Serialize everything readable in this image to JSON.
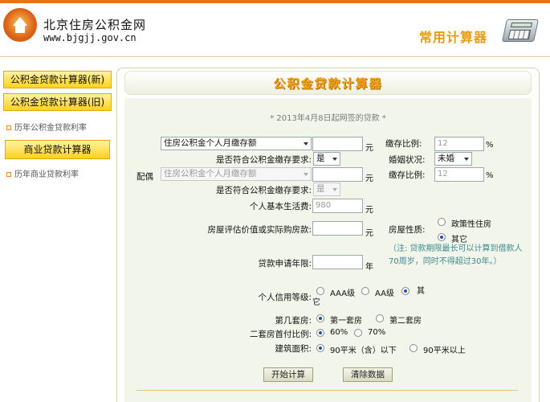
{
  "header": {
    "site_title": "北京住房公积金网",
    "site_url": "www.bjgjj.gov.cn",
    "calc_title": "常用计算器"
  },
  "sidebar": {
    "items": [
      {
        "label": "公积金贷款计算器(新)",
        "type": "button"
      },
      {
        "label": "公积金贷款计算器(旧)",
        "type": "button"
      },
      {
        "label": "历年公积金贷款利率",
        "type": "link"
      },
      {
        "label": "商业贷款计算器",
        "type": "button"
      },
      {
        "label": "历年商业贷款利率",
        "type": "link"
      }
    ]
  },
  "panel": {
    "title": "公积金贷款计算器",
    "note": "* 2013年4月8日起网签的贷款 *"
  },
  "form": {
    "deposit_type_select": "住房公积金个人月缴存额",
    "deposit_unit": "元",
    "deposit_ratio_label": "缴存比例:",
    "deposit_ratio_value": "12",
    "percent": "%",
    "meets_req_label": "是否符合公积金缴存要求:",
    "meets_req_value": "是",
    "marital_label": "婚姻状况:",
    "marital_value": "未婚",
    "spouse_label": "配偶",
    "spouse_deposit_select": "住房公积金个人月缴存额",
    "spouse_ratio_label": "缴存比例:",
    "spouse_ratio_value": "12",
    "spouse_meets_req_label": "是否符合公积金缴存要求:",
    "spouse_meets_req_value": "是",
    "living_cost_label": "个人基本生活费:",
    "living_cost_value": "980",
    "price_label": "房屋评估价值或实际购房款:",
    "property_label": "房屋性质:",
    "property_opt1": "政策性住房",
    "property_opt2": "其它",
    "years_label": "贷款申请年限:",
    "years_unit": "年",
    "hint": "（注: 贷款期限最长可以计算到借款人70周岁，同时不得超过30年。）",
    "credit_label": "个人信用等级:",
    "credit_opt1": "AAA级",
    "credit_opt2": "AA级",
    "credit_opt3": "其它",
    "house_num_label": "第几套房:",
    "house_num_opt1": "第一套房",
    "house_num_opt2": "第二套房",
    "down_payment_label": "二套房首付比例:",
    "down_opt1": "60%",
    "down_opt2": "70%",
    "area_label": "建筑面积:",
    "area_opt1": "90平米（含）以下",
    "area_opt2": "90平米以上",
    "calc_button": "开始计算",
    "clear_button": "清除数据"
  },
  "colors": {
    "accent_orange": "#e5741c",
    "side_button_yellow": "#ffd21a",
    "title_orange": "#f0a018",
    "form_bg": "#f2f5e9",
    "hint_teal": "#3b8a8f"
  }
}
